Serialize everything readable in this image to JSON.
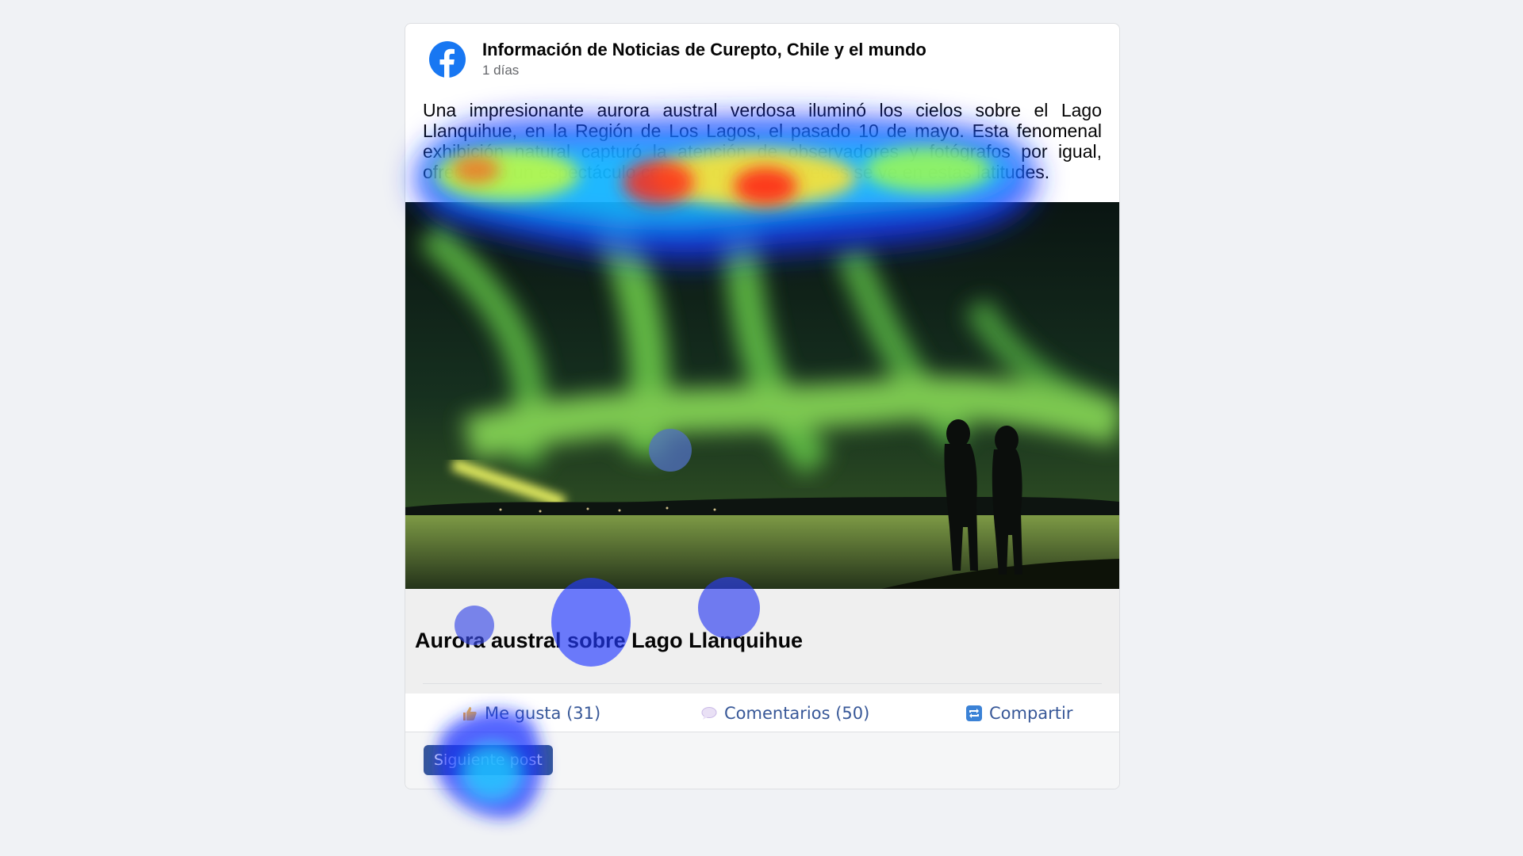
{
  "post": {
    "page_name": "Información de Noticias de Curepto, Chile y el mundo",
    "time": "1 días",
    "text": "Una impresionante aurora austral verdosa iluminó los cielos sobre el Lago Llanquihue, en la Región de Los Lagos, el pasado 10 de mayo. Esta fenomenal exhibición natural capturó la atención de observadores y fotógrafos por igual, ofreciendo un espectáculo celestial que pocas veces se ve en estas latitudes.",
    "image_caption": "Aurora austral sobre Lago Llanquihue"
  },
  "actions": {
    "like": "Me gusta (31)",
    "comment": "Comentarios (50)",
    "share": "Compartir"
  },
  "footer": {
    "next_button": "Siguiente post"
  },
  "icons": {
    "logo": "facebook-logo-icon",
    "like": "thumbs-up-icon",
    "comment": "speech-bubble-icon",
    "share": "share-arrows-icon"
  },
  "colors": {
    "facebook_blue": "#1877f2",
    "link_blue": "#385898",
    "background": "#f0f2f5"
  }
}
